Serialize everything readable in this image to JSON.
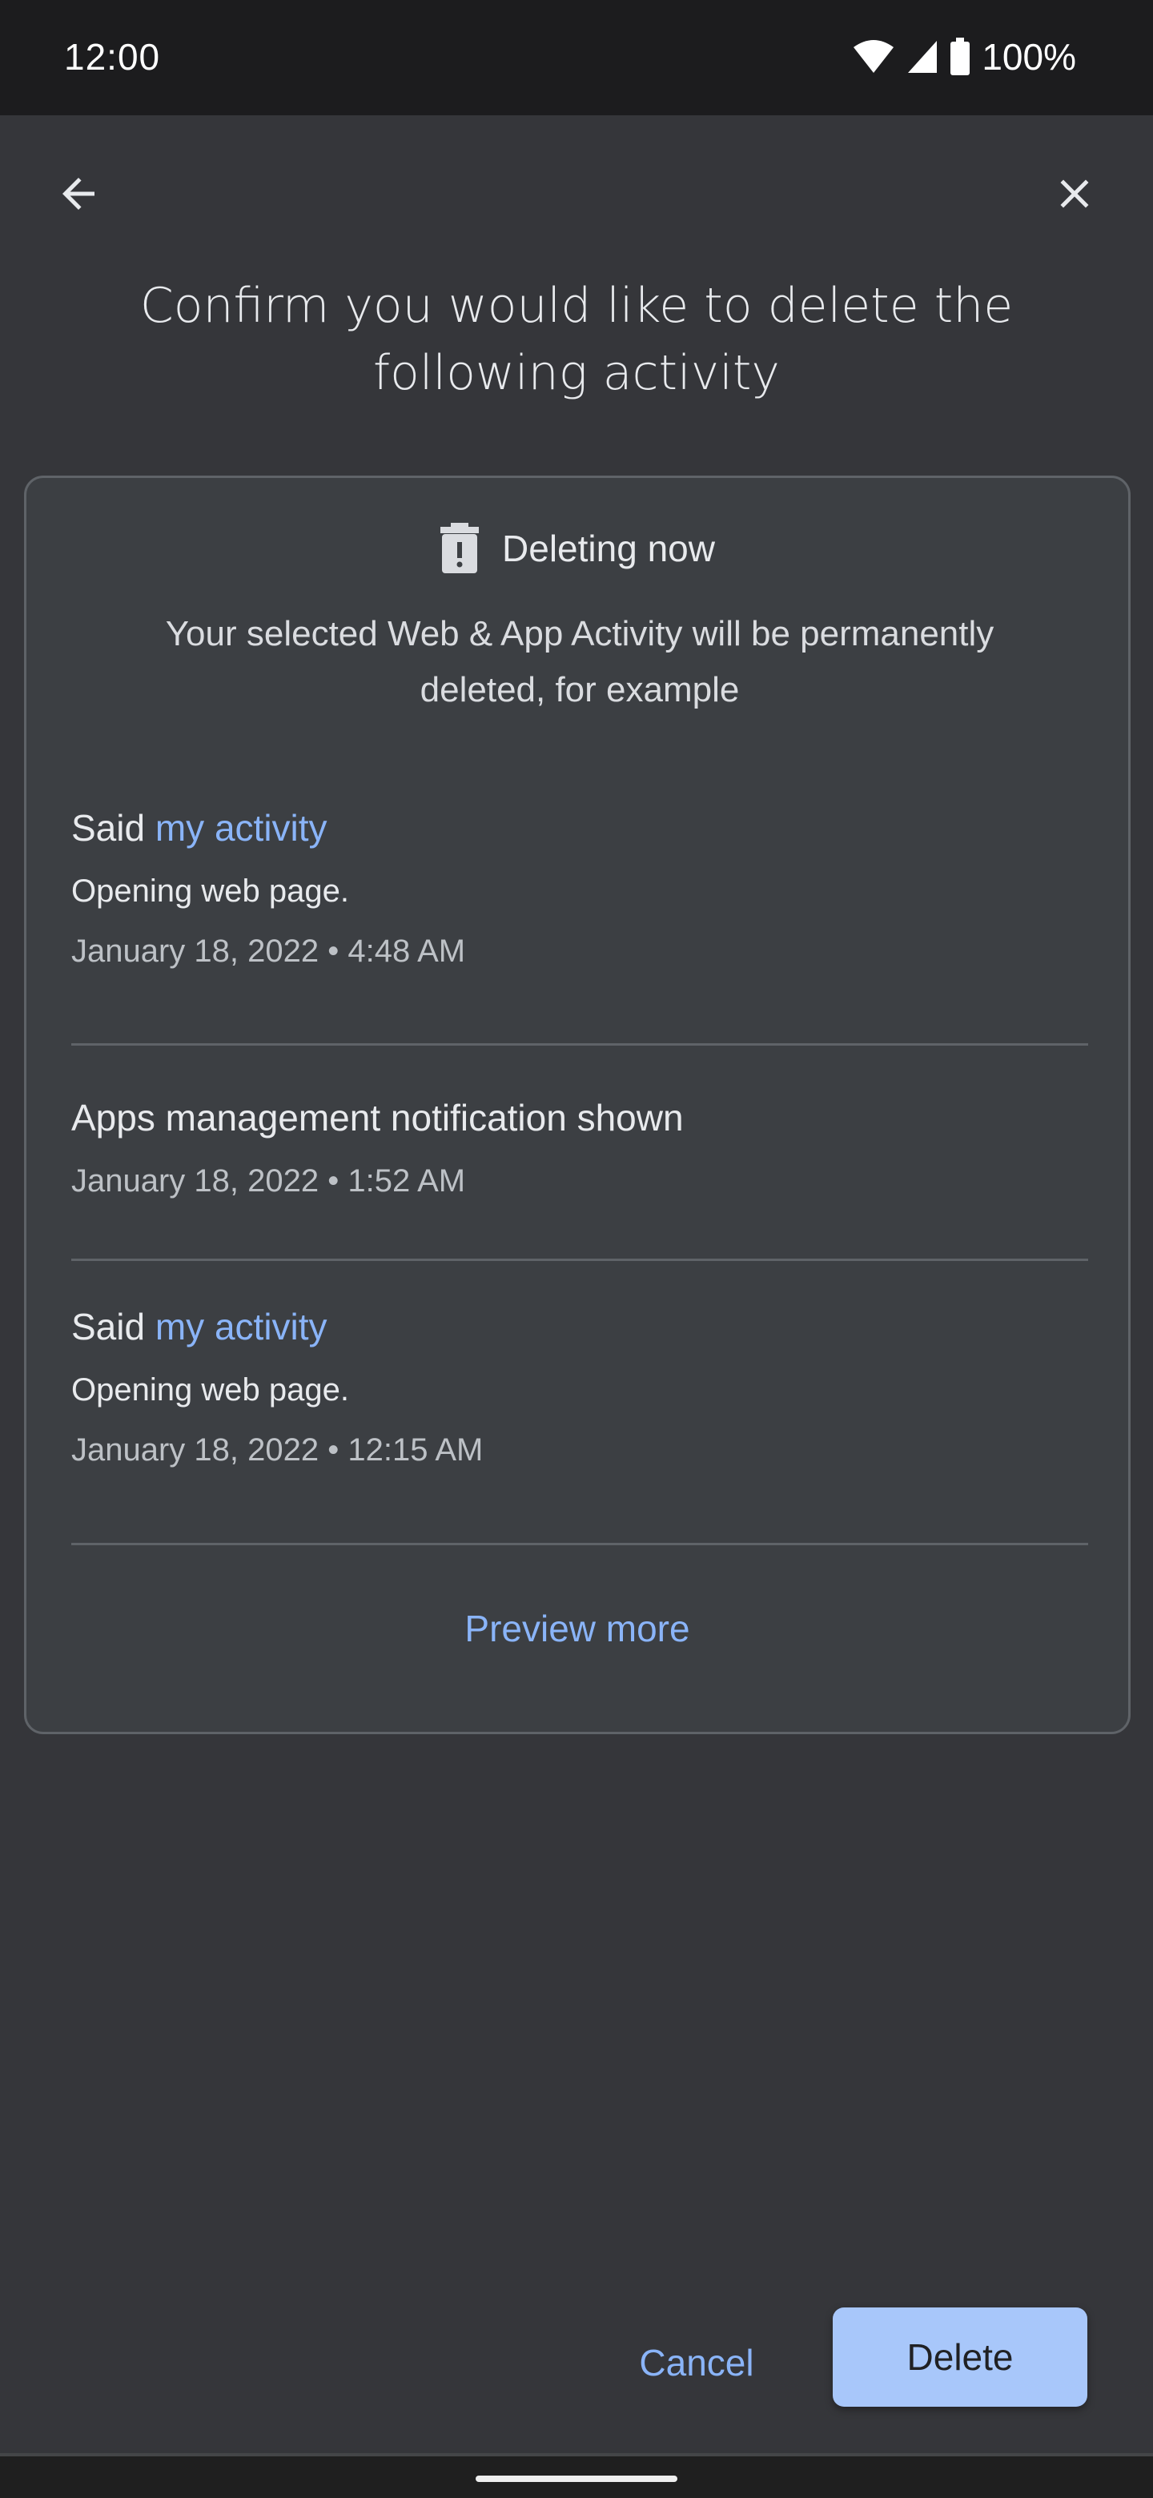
{
  "status_bar": {
    "time": "12:00",
    "battery_percent": "100%",
    "icons": [
      "wifi-icon",
      "signal-icon",
      "battery-icon"
    ]
  },
  "toolbar": {
    "back_icon": "arrow-back-icon",
    "close_icon": "close-icon"
  },
  "page": {
    "title": "Confirm you would like to delete the following activity"
  },
  "card": {
    "icon": "trash-alert-icon",
    "heading": "Deleting now",
    "description": "Your selected Web & App Activity will be permanently deleted, for example",
    "items": [
      {
        "prefix": "Said",
        "link": "my activity",
        "subtitle": "Opening web page.",
        "date": "January 18, 2022 • 4:48 AM"
      },
      {
        "prefix": "Apps management notification shown",
        "link": "",
        "subtitle": "",
        "date": "January 18, 2022 • 1:52 AM"
      },
      {
        "prefix": "Said",
        "link": "my activity",
        "subtitle": "Opening web page.",
        "date": "January 18, 2022 • 12:15 AM"
      }
    ],
    "preview_more": "Preview more"
  },
  "actions": {
    "cancel": "Cancel",
    "delete": "Delete"
  },
  "colors": {
    "accent": "#8ab4f8",
    "primary_button": "#a8c7fa",
    "background": "#35363a",
    "card": "#3c3f43"
  }
}
